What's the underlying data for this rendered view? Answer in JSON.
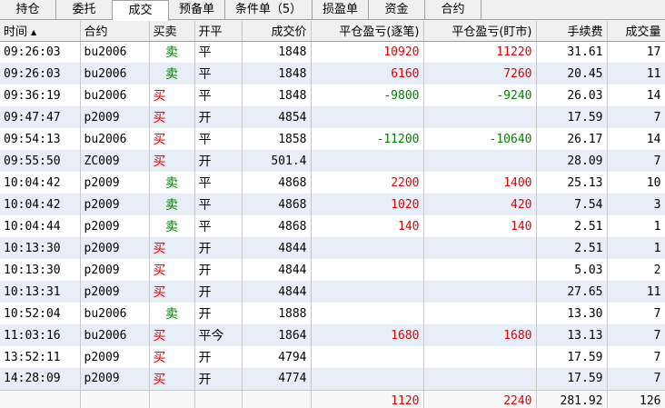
{
  "tabs": [
    {
      "label": "持仓",
      "active": false
    },
    {
      "label": "委托",
      "active": false
    },
    {
      "label": "成交",
      "active": true
    },
    {
      "label": "预备单",
      "active": false
    },
    {
      "label": "条件单（5）",
      "active": false
    },
    {
      "label": "损盈单",
      "active": false
    },
    {
      "label": "资金",
      "active": false
    },
    {
      "label": "合约",
      "active": false
    }
  ],
  "columns": {
    "time": "时间",
    "sort_indicator": "▲",
    "contract": "合约",
    "direction": "买卖",
    "open_close": "开平",
    "price": "成交价",
    "pnl_tick": "平仓盈亏(逐笔)",
    "pnl_mark": "平仓盈亏(盯市)",
    "fee": "手续费",
    "volume": "成交量"
  },
  "colors": {
    "buy": "#e00000",
    "sell": "#008000",
    "profit": "#e00000",
    "loss": "#008000"
  },
  "rows": [
    {
      "time": "09:26:03",
      "contract": "bu2006",
      "direction": "卖",
      "side": "sell",
      "open_close": "平",
      "price": "1848",
      "pnl_tick": "10920",
      "pnl_mark": "11220",
      "fee": "31.61",
      "volume": "17"
    },
    {
      "time": "09:26:03",
      "contract": "bu2006",
      "direction": "卖",
      "side": "sell",
      "open_close": "平",
      "price": "1848",
      "pnl_tick": "6160",
      "pnl_mark": "7260",
      "fee": "20.45",
      "volume": "11"
    },
    {
      "time": "09:36:19",
      "contract": "bu2006",
      "direction": "买",
      "side": "buy",
      "open_close": "平",
      "price": "1848",
      "pnl_tick": "-9800",
      "pnl_mark": "-9240",
      "fee": "26.03",
      "volume": "14"
    },
    {
      "time": "09:47:47",
      "contract": "p2009",
      "direction": "买",
      "side": "buy",
      "open_close": "开",
      "price": "4854",
      "pnl_tick": "",
      "pnl_mark": "",
      "fee": "17.59",
      "volume": "7"
    },
    {
      "time": "09:54:13",
      "contract": "bu2006",
      "direction": "买",
      "side": "buy",
      "open_close": "平",
      "price": "1858",
      "pnl_tick": "-11200",
      "pnl_mark": "-10640",
      "fee": "26.17",
      "volume": "14"
    },
    {
      "time": "09:55:50",
      "contract": "ZC009",
      "direction": "买",
      "side": "buy",
      "open_close": "开",
      "price": "501.4",
      "pnl_tick": "",
      "pnl_mark": "",
      "fee": "28.09",
      "volume": "7"
    },
    {
      "time": "10:04:42",
      "contract": "p2009",
      "direction": "卖",
      "side": "sell",
      "open_close": "平",
      "price": "4868",
      "pnl_tick": "2200",
      "pnl_mark": "1400",
      "fee": "25.13",
      "volume": "10"
    },
    {
      "time": "10:04:42",
      "contract": "p2009",
      "direction": "卖",
      "side": "sell",
      "open_close": "平",
      "price": "4868",
      "pnl_tick": "1020",
      "pnl_mark": "420",
      "fee": "7.54",
      "volume": "3"
    },
    {
      "time": "10:04:44",
      "contract": "p2009",
      "direction": "卖",
      "side": "sell",
      "open_close": "平",
      "price": "4868",
      "pnl_tick": "140",
      "pnl_mark": "140",
      "fee": "2.51",
      "volume": "1"
    },
    {
      "time": "10:13:30",
      "contract": "p2009",
      "direction": "买",
      "side": "buy",
      "open_close": "开",
      "price": "4844",
      "pnl_tick": "",
      "pnl_mark": "",
      "fee": "2.51",
      "volume": "1"
    },
    {
      "time": "10:13:30",
      "contract": "p2009",
      "direction": "买",
      "side": "buy",
      "open_close": "开",
      "price": "4844",
      "pnl_tick": "",
      "pnl_mark": "",
      "fee": "5.03",
      "volume": "2"
    },
    {
      "time": "10:13:31",
      "contract": "p2009",
      "direction": "买",
      "side": "buy",
      "open_close": "开",
      "price": "4844",
      "pnl_tick": "",
      "pnl_mark": "",
      "fee": "27.65",
      "volume": "11"
    },
    {
      "time": "10:52:04",
      "contract": "bu2006",
      "direction": "卖",
      "side": "sell",
      "open_close": "开",
      "price": "1888",
      "pnl_tick": "",
      "pnl_mark": "",
      "fee": "13.30",
      "volume": "7"
    },
    {
      "time": "11:03:16",
      "contract": "bu2006",
      "direction": "买",
      "side": "buy",
      "open_close": "平今",
      "price": "1864",
      "pnl_tick": "1680",
      "pnl_mark": "1680",
      "fee": "13.13",
      "volume": "7"
    },
    {
      "time": "13:52:11",
      "contract": "p2009",
      "direction": "买",
      "side": "buy",
      "open_close": "开",
      "price": "4794",
      "pnl_tick": "",
      "pnl_mark": "",
      "fee": "17.59",
      "volume": "7"
    },
    {
      "time": "14:28:09",
      "contract": "p2009",
      "direction": "买",
      "side": "buy",
      "open_close": "开",
      "price": "4774",
      "pnl_tick": "",
      "pnl_mark": "",
      "fee": "17.59",
      "volume": "7"
    }
  ],
  "totals": {
    "pnl_tick": "1120",
    "pnl_mark": "2240",
    "fee": "281.92",
    "volume": "126"
  }
}
